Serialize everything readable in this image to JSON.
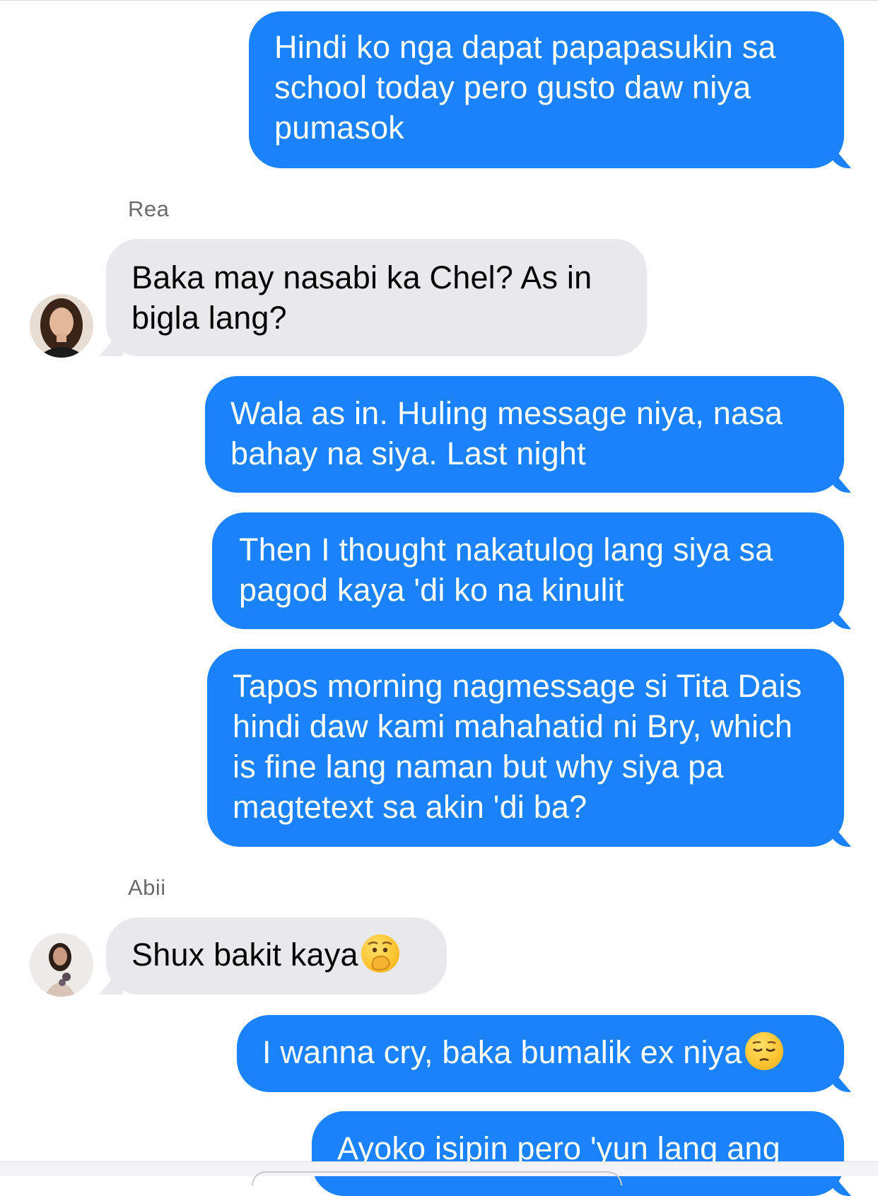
{
  "messages": [
    {
      "direction": "out",
      "text": "Hindi ko nga dapat papapasukin sa school today pero gusto daw niya pumasok"
    },
    {
      "direction": "in",
      "sender": "Rea",
      "text": "Baka may nasabi ka Chel? As in bigla lang?"
    },
    {
      "direction": "out",
      "text": "Wala as in. Huling message niya, nasa bahay na siya. Last night"
    },
    {
      "direction": "out",
      "text": "Then I thought nakatulog lang siya sa pagod kaya 'di ko na kinulit"
    },
    {
      "direction": "out",
      "text": "Tapos morning nagmessage si Tita Dais hindi daw kami mahahatid ni Bry, which is fine lang naman but why siya pa magtetext sa akin 'di ba?"
    },
    {
      "direction": "in",
      "sender": "Abii",
      "text": "Shux bakit kaya",
      "emoji": "face-with-hand-over-mouth-emoji"
    },
    {
      "direction": "out",
      "text": "I wanna cry, baka bumalik ex niya",
      "emoji": "pensive-face-emoji"
    },
    {
      "direction": "out",
      "text": "Ayoko isipin pero 'yun lang ang"
    }
  ],
  "colors": {
    "outgoing_bubble": "#1a82fb",
    "incoming_bubble": "#e9e9eb",
    "sender_name": "#6b6b6b"
  }
}
